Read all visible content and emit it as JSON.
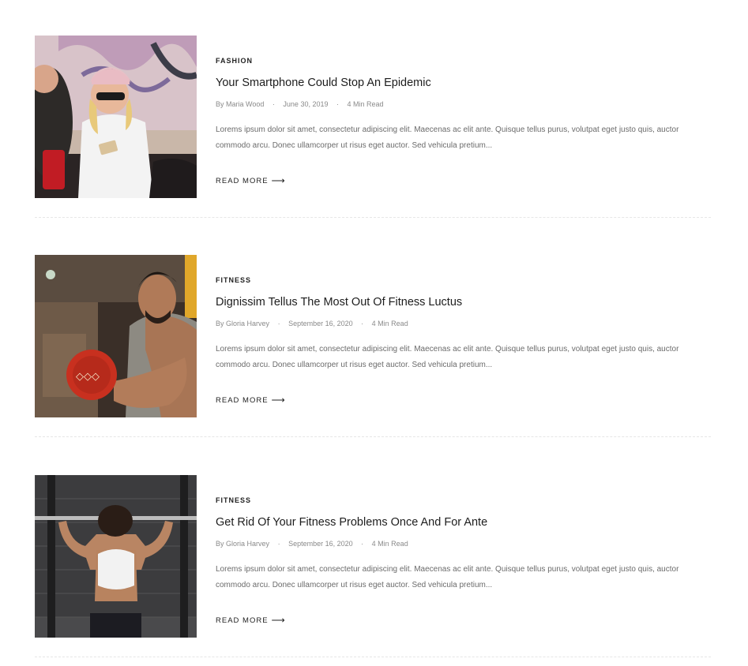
{
  "posts": [
    {
      "category": "FASHION",
      "title": "Your Smartphone Could Stop An Epidemic",
      "meta": {
        "by": "By",
        "author": "Maria Wood",
        "date": "June 30, 2019",
        "read_time": "4 Min Read"
      },
      "excerpt": "Lorems ipsum dolor sit amet, consectetur adipiscing elit. Maecenas ac elit ante. Quisque tellus purus, volutpat eget justo quis, auctor commodo arcu. Donec ullamcorper ut risus eget auctor. Sed vehicula pretium...",
      "read_more": "READ MORE"
    },
    {
      "category": "FITNESS",
      "title": "Dignissim Tellus The Most Out Of Fitness Luctus",
      "meta": {
        "by": "By",
        "author": "Gloria Harvey",
        "date": "September 16, 2020",
        "read_time": "4 Min Read"
      },
      "excerpt": "Lorems ipsum dolor sit amet, consectetur adipiscing elit. Maecenas ac elit ante. Quisque tellus purus, volutpat eget justo quis, auctor commodo arcu. Donec ullamcorper ut risus eget auctor. Sed vehicula pretium...",
      "read_more": "READ MORE"
    },
    {
      "category": "FITNESS",
      "title": "Get Rid Of Your Fitness Problems Once And For Ante",
      "meta": {
        "by": "By",
        "author": "Gloria Harvey",
        "date": "September 16, 2020",
        "read_time": "4 Min Read"
      },
      "excerpt": "Lorems ipsum dolor sit amet, consectetur adipiscing elit. Maecenas ac elit ante. Quisque tellus purus, volutpat eget justo quis, auctor commodo arcu. Donec ullamcorper ut risus eget auctor. Sed vehicula pretium...",
      "read_more": "READ MORE"
    }
  ],
  "icons": {
    "read_more_arrow": "arrow-right-icon",
    "meta_separator": "dot-separator-icon"
  }
}
